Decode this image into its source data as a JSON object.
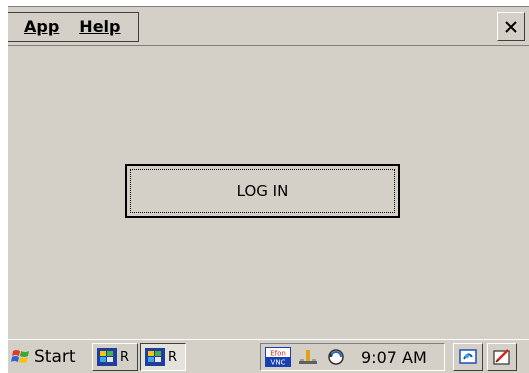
{
  "menu": {
    "app_label": "App",
    "help_label": "Help"
  },
  "window": {
    "close_icon": "close-icon"
  },
  "main": {
    "login_button_label": "LOG IN"
  },
  "taskbar": {
    "start_label": "Start",
    "tasks": [
      {
        "label": "R",
        "icon": "app-icon",
        "state": "raised"
      },
      {
        "label": "R",
        "icon": "app-icon",
        "state": "pressed"
      }
    ],
    "tray": {
      "vnc_top": "Efon",
      "vnc_bottom": "VNC",
      "clock": "9:07 AM"
    }
  },
  "colors": {
    "face": "#d4d0c8",
    "shadow": "#808080",
    "dark_shadow": "#404040",
    "highlight": "#ffffff"
  }
}
